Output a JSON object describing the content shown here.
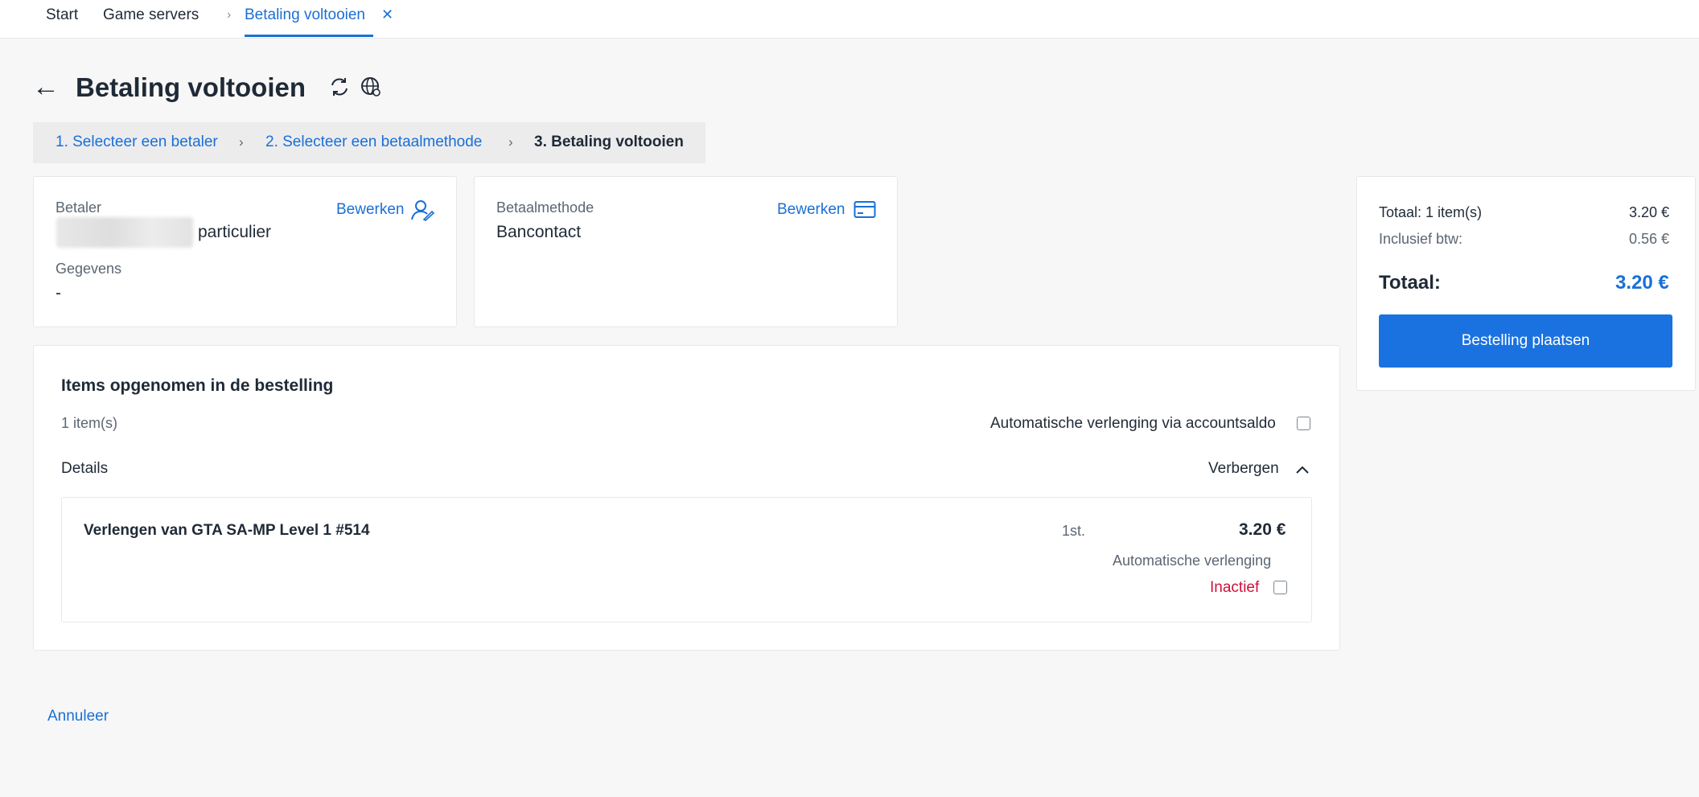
{
  "tabs": {
    "start": "Start",
    "game_servers": "Game servers",
    "active": "Betaling voltooien",
    "close_symbol": "✕"
  },
  "header": {
    "back_symbol": "←",
    "title": "Betaling voltooien"
  },
  "steps": [
    {
      "label": "1. Selecteer een betaler"
    },
    {
      "label": "2. Selecteer een betaalmethode"
    },
    {
      "label": "3. Betaling voltooien"
    }
  ],
  "payer_card": {
    "payer_label": "Betaler",
    "payer_type": "particulier",
    "edit_label": "Bewerken",
    "details_label": "Gegevens",
    "details_value": "-"
  },
  "method_card": {
    "method_label": "Betaalmethode",
    "method_value": "Bancontact",
    "edit_label": "Bewerken"
  },
  "items_section": {
    "title": "Items opgenomen in de bestelling",
    "count": "1 item(s)",
    "auto_renew_label": "Automatische verlenging via accountsaldo",
    "details_label": "Details",
    "hide_label": "Verbergen",
    "item": {
      "name": "Verlengen van GTA SA-MP Level 1 #514",
      "quantity": "1st.",
      "price": "3.20 €",
      "auto_renew_label": "Automatische verlenging",
      "status": "Inactief"
    }
  },
  "summary": {
    "total_items_label": "Totaal: 1 item(s)",
    "total_items_value": "3.20 €",
    "vat_label": "Inclusief btw:",
    "vat_value": "0.56 €",
    "total_label": "Totaal:",
    "total_value": "3.20 €",
    "place_order_button": "Bestelling plaatsen"
  },
  "footer": {
    "cancel_label": "Annuleer"
  },
  "colors": {
    "accent": "#1a72e0",
    "link": "#1a6fd6",
    "inactive": "#d0103a"
  },
  "icons": [
    "refresh-icon",
    "globe-icon",
    "user-edit-icon",
    "card-icon",
    "chevron-up-icon",
    "chevron-right-icon",
    "back-arrow-icon",
    "close-icon"
  ]
}
